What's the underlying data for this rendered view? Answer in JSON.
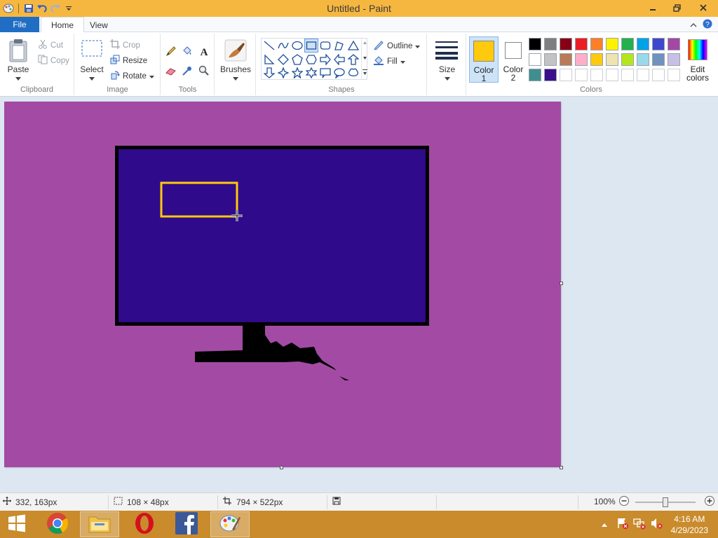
{
  "window": {
    "title": "Untitled - Paint"
  },
  "tabs": {
    "file": "File",
    "home": "Home",
    "view": "View"
  },
  "clipboard": {
    "paste": "Paste",
    "cut": "Cut",
    "copy": "Copy",
    "group": "Clipboard"
  },
  "image": {
    "select": "Select",
    "crop": "Crop",
    "resize": "Resize",
    "rotate": "Rotate",
    "group": "Image"
  },
  "tools": {
    "group": "Tools"
  },
  "brushes": {
    "label": "Brushes"
  },
  "shapes": {
    "outline": "Outline",
    "fill": "Fill",
    "group": "Shapes"
  },
  "size": {
    "label": "Size"
  },
  "colors": {
    "color1": "Color",
    "color1_num": "1",
    "color2": "Color",
    "color2_num": "2",
    "edit": "Edit",
    "edit2": "colors",
    "group": "Colors",
    "color1_value": "#ffc90e",
    "color2_value": "#ffffff",
    "palette_row1": [
      "#000000",
      "#7f7f7f",
      "#880015",
      "#ed1c24",
      "#ff7f27",
      "#fff200",
      "#22b14c",
      "#00a2e8",
      "#3f48cc",
      "#a349a4"
    ],
    "palette_row2": [
      "#ffffff",
      "#c3c3c3",
      "#b97a57",
      "#ffaec9",
      "#ffc90e",
      "#efe4b0",
      "#b5e61d",
      "#99d9ea",
      "#7092be",
      "#c8bfe7"
    ],
    "palette_row3": [
      "#3f8f8f",
      "#3a0f8c"
    ]
  },
  "canvas_colors": {
    "background": "#a34ba4",
    "screen": "#2f0a8a",
    "bezel": "#000000",
    "rect": "#ffc90e"
  },
  "status": {
    "cursor_pos": "332, 163px",
    "selection_size": "108 × 48px",
    "canvas_size": "794 × 522px",
    "zoom": "100%"
  },
  "taskbar": {
    "time": "4:16 AM",
    "date": "4/29/2023"
  }
}
